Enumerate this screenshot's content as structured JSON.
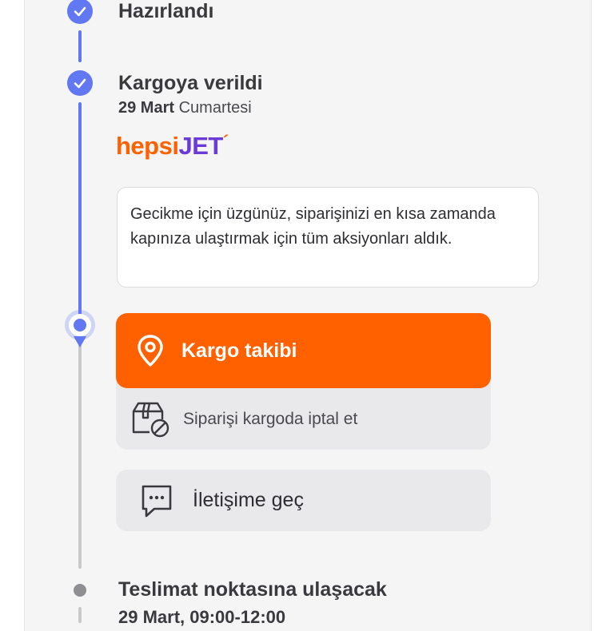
{
  "timeline": {
    "steps": [
      {
        "title": "Hazırlandı"
      },
      {
        "title": "Kargoya verildi",
        "date_bold": "29 Mart",
        "date_rest": "Cumartesi"
      },
      {
        "title": "Teslimat noktasına ulaşacak",
        "date": "29 Mart, 09:00-12:00"
      }
    ],
    "carrier": {
      "part1": "hepsi",
      "part2": "JET",
      "mark": "´"
    },
    "notice": "Gecikme için üzgünüz, siparişinizi en kısa zamanda kapınıza ulaştırmak için tüm aksiyonları aldık.",
    "actions": {
      "track_label": "Kargo takibi",
      "cancel_label": "Siparişi kargoda iptal et",
      "contact_label": "İletişime geç"
    }
  },
  "colors": {
    "accent": "#ff6000",
    "timeline_active": "#6178f2",
    "timeline_inactive": "#c9c9cc",
    "brand_purple": "#6a3bd6"
  },
  "icons": {
    "done": "check-icon",
    "track": "location-pin-icon",
    "cancel": "package-cancel-icon",
    "contact": "chat-bubble-icon"
  }
}
